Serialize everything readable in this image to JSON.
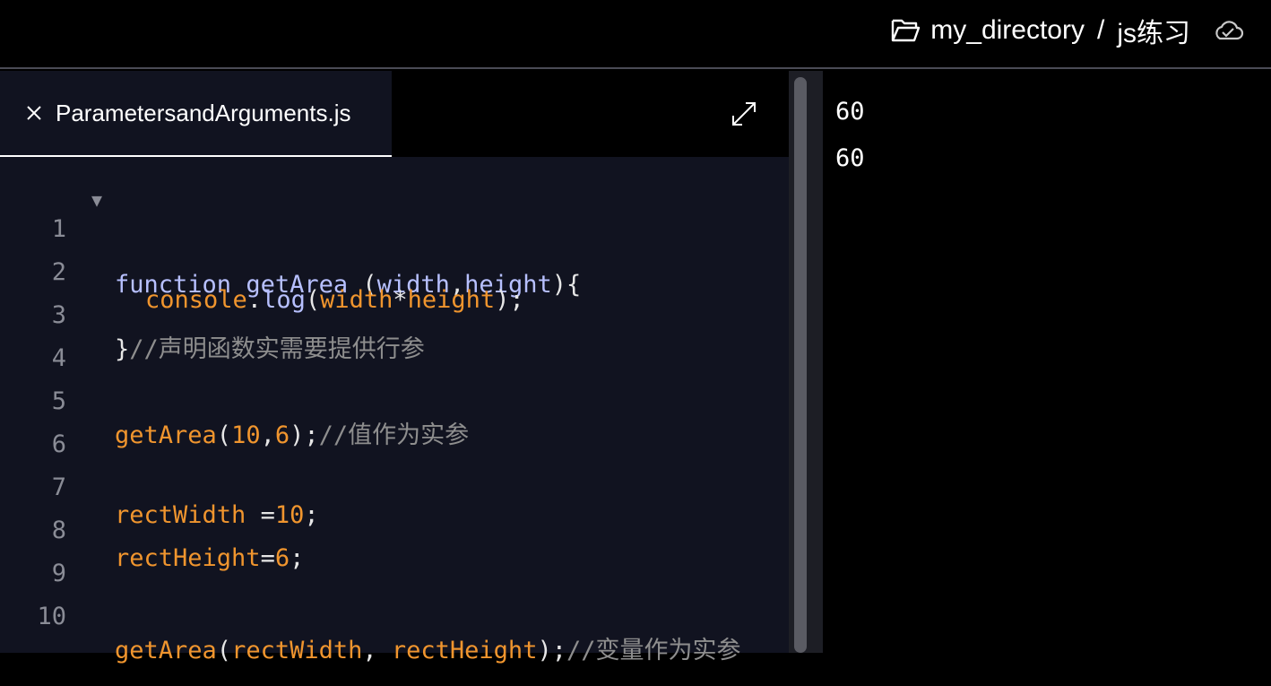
{
  "header": {
    "directory": "my_directory",
    "separator": "/",
    "project": "js练习",
    "folder_icon": "folder-open-icon",
    "sync_icon": "cloud-check-icon"
  },
  "editor": {
    "tab": {
      "filename": "ParametersandArguments.js",
      "close_icon": "close-icon"
    },
    "expand_icon": "expand-icon",
    "lines": [
      {
        "n": "1"
      },
      {
        "n": "2"
      },
      {
        "n": "3"
      },
      {
        "n": "4"
      },
      {
        "n": "5"
      },
      {
        "n": "6"
      },
      {
        "n": "7"
      },
      {
        "n": "8"
      },
      {
        "n": "9"
      },
      {
        "n": "10"
      }
    ],
    "code": {
      "l1": {
        "kw": "function",
        "name": "getArea",
        "open": " (",
        "p1": "width",
        "comma": ",",
        "p2": "height",
        "close": "){"
      },
      "l2": {
        "obj": "console",
        "dot": ".",
        "method": "log",
        "open": "(",
        "a": "width",
        "op": "*",
        "b": "height",
        "end": ");"
      },
      "l3": {
        "brace": "}",
        "comment": "//声明函数实需要提供行参"
      },
      "l5": {
        "fn": "getArea",
        "open": "(",
        "a": "10",
        "comma": ",",
        "b": "6",
        "end": ");",
        "comment": "//值作为实参"
      },
      "l7": {
        "var": "rectWidth",
        "eq": " =",
        "val": "10",
        "end": ";"
      },
      "l8": {
        "var": "rectHeight",
        "eq": "=",
        "val": "6",
        "end": ";"
      },
      "l10": {
        "fn": "getArea",
        "open": "(",
        "a": "rectWidth",
        "comma": ", ",
        "b": "rectHeight",
        "end": ");",
        "comment": "//变量作为实参"
      }
    }
  },
  "console": {
    "output": [
      "60",
      "60"
    ]
  }
}
